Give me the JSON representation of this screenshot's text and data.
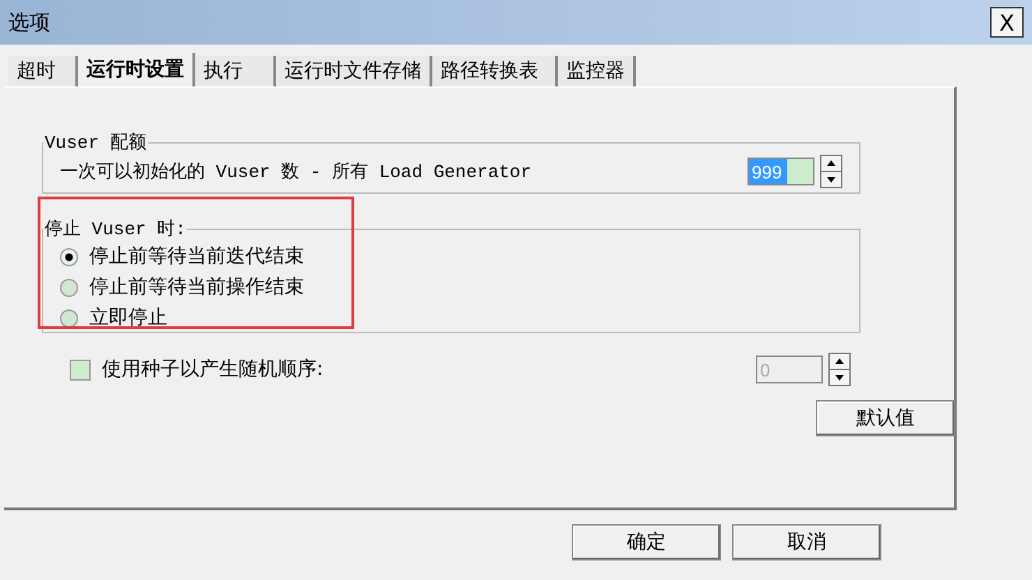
{
  "window": {
    "title": "选项",
    "close": "X"
  },
  "tabs": [
    {
      "label": "超时",
      "selected": false
    },
    {
      "label": "运行时设置",
      "selected": true
    },
    {
      "label": "执行",
      "selected": false
    },
    {
      "label": "运行时文件存储",
      "selected": false
    },
    {
      "label": "路径转换表",
      "selected": false
    },
    {
      "label": "监控器",
      "selected": false
    }
  ],
  "quota": {
    "title": "Vuser 配额",
    "label": "一次可以初始化的 Vuser 数 - 所有 Load Generator",
    "value": "999"
  },
  "stop": {
    "title": "停止 Vuser 时:",
    "options": [
      {
        "label": "停止前等待当前迭代结束",
        "selected": true
      },
      {
        "label": "停止前等待当前操作结束",
        "selected": false
      },
      {
        "label": "立即停止",
        "selected": false
      }
    ]
  },
  "seed": {
    "label": "使用种子以产生随机顺序:",
    "checked": false,
    "value": "0"
  },
  "default_button": "默认值",
  "buttons": [
    "确定",
    "取消"
  ]
}
